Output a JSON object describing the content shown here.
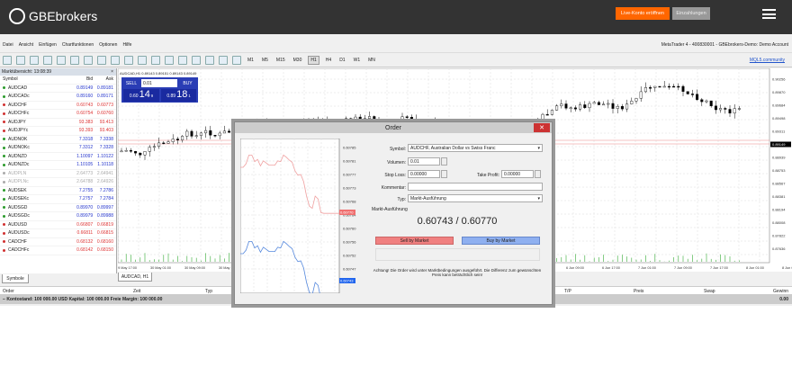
{
  "site": {
    "logo": "GBEbrokers",
    "live_button": "Live-Konto eröffnen",
    "deposit_button": "Einzahlungen"
  },
  "menu": [
    "Datei",
    "Ansicht",
    "Einfügen",
    "Chartfunktionen",
    "Optionen",
    "Hilfe"
  ],
  "window_title": "MetaTrader 4 - 400830001 - GBEbrokers-Demo: Demo Account",
  "toolbar": {
    "timeframes": [
      "M1",
      "M5",
      "M15",
      "M30",
      "H1",
      "H4",
      "D1",
      "W1",
      "MN"
    ],
    "active": "H1",
    "mql": "MQL5.community"
  },
  "market_watch": {
    "title": "Marktübersicht: 13:08:39",
    "cols": [
      "Symbol",
      "Bid",
      "Ask"
    ],
    "tab": "Symbole",
    "rows": [
      [
        "AUDCAD",
        "0.89149",
        "0.89181",
        "up"
      ],
      [
        "AUDCADc",
        "0.89160",
        "0.89171",
        "up"
      ],
      [
        "AUDCHF",
        "0.60743",
        "0.60773",
        "down"
      ],
      [
        "AUDCHFc",
        "0.60754",
        "0.60760",
        "down"
      ],
      [
        "AUDJPY",
        "93.383",
        "93.413",
        "down"
      ],
      [
        "AUDJPYc",
        "93.393",
        "93.403",
        "down"
      ],
      [
        "AUDNOK",
        "7.3318",
        "7.3338",
        "up"
      ],
      [
        "AUDNOKc",
        "7.3312",
        "7.3328",
        "up"
      ],
      [
        "AUDNZD",
        "1.10097",
        "1.10122",
        "up"
      ],
      [
        "AUDNZDc",
        "1.10105",
        "1.10118",
        "up"
      ],
      [
        "AUDPLN",
        "2.64773",
        "2.64941",
        "none"
      ],
      [
        "AUDPLNc",
        "2.64788",
        "2.64926",
        "none"
      ],
      [
        "AUDSEK",
        "7.2755",
        "7.2786",
        "up"
      ],
      [
        "AUDSEKc",
        "7.2757",
        "7.2784",
        "up"
      ],
      [
        "AUDSGD",
        "0.89970",
        "0.89997",
        "up"
      ],
      [
        "AUDSGDc",
        "0.89979",
        "0.89988",
        "up"
      ],
      [
        "AUDUSD",
        "0.66807",
        "0.66819",
        "down"
      ],
      [
        "AUDUSDc",
        "0.66811",
        "0.66815",
        "down"
      ],
      [
        "CADCHF",
        "0.68132",
        "0.68160",
        "down"
      ],
      [
        "CADCHFc",
        "0.68142",
        "0.68150",
        "down"
      ]
    ]
  },
  "chart": {
    "header": "AUDCAD,H1  0.89143 0.89151 0.89143 0.89149",
    "tab": "AUDCAD, H1",
    "current_price": "0.89149",
    "y_labels": [
      "0.90256",
      "0.89870",
      "0.89684",
      "0.89498",
      "0.89311",
      "0.89149",
      "0.88939",
      "0.88753",
      "0.88567",
      "0.88381",
      "0.88194",
      "0.88008",
      "0.87822",
      "0.87636"
    ],
    "x_labels": [
      "29 May 17:00",
      "30 May 01:00",
      "30 May 09:00",
      "30 May 17:00",
      "6 Jun 09:00",
      "6 Jun 17:00",
      "7 Jun 01:00",
      "7 Jun 09:00",
      "7 Jun 17:00",
      "8 Jun 01:00",
      "8 Jun 09:00"
    ],
    "one_click": {
      "sell": "SELL",
      "buy": "BUY",
      "volume": "0.01",
      "sell_small": "0.60",
      "sell_big": "14",
      "sell_sup": "9",
      "buy_small": "0.89",
      "buy_big": "18",
      "buy_sup": "1"
    }
  },
  "terminal": {
    "cols": [
      "Order",
      "Zeit",
      "Typ",
      "T/P",
      "Preis",
      "Swap",
      "Gewinn"
    ],
    "balance": "Kontostand: 100 000.00 USD  Kapital: 100 000.00  Freie Margin: 100 000.00",
    "profit": "0.00"
  },
  "order_dialog": {
    "title": "Order",
    "symbol_label": "Symbol:",
    "symbol": "AUDCHF, Australian Dollar vs Swiss Franc",
    "volume_label": "Volumen:",
    "volume": "0.01",
    "sl_label": "Stop Loss:",
    "sl": "0.00000",
    "tp_label": "Take Profit:",
    "tp": "0.00000",
    "comment_label": "Kommentar:",
    "comment": "",
    "type_label": "Typ:",
    "type": "Markt-Ausführung",
    "section": "Markt-Ausführung",
    "quote": "0.60743 / 0.60770",
    "sell_button": "Sell by Market",
    "buy_button": "Buy by Market",
    "warning": "Achtung! Die Order wird unter Marktbedingungen ausgeführt. Die Differenz zum gewünschten Preis kann beträchtlich sein!",
    "tick_labels": [
      "0.60785",
      "0.60781",
      "0.60777",
      "0.60773",
      "0.60768",
      "0.60764",
      "0.60760",
      "0.60756",
      "0.60752",
      "0.60747"
    ],
    "ask_tag": "0.60770",
    "bid_tag": "0.60743"
  },
  "colors": {
    "up": "#2a9a2a",
    "down": "#d03030",
    "bid_up": "#2233cc",
    "bid_down": "#dd3333",
    "sell": "#f08080",
    "buy": "#8fb0f0",
    "accent": "#ff6600"
  }
}
